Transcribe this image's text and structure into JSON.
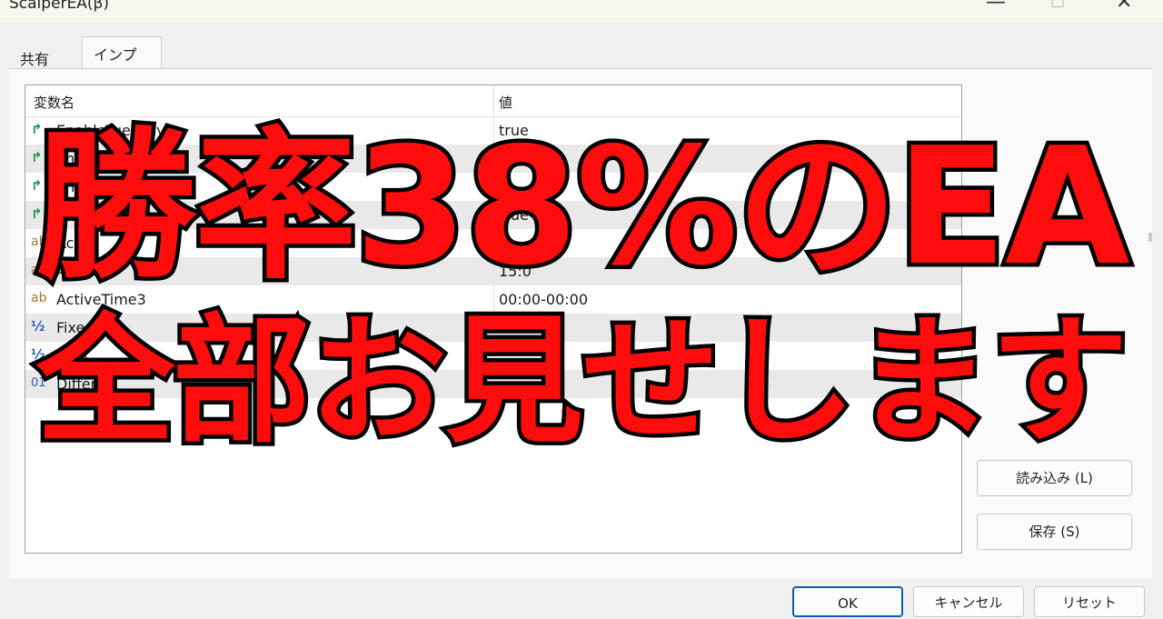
{
  "window": {
    "title": "ScalperEA(β)",
    "minimize_glyph": "—",
    "maximize_glyph": "☐",
    "close_glyph": "✕"
  },
  "tabs": [
    {
      "label": "共有",
      "active": false
    },
    {
      "label": "インプット",
      "active": true
    }
  ],
  "grid": {
    "columns": {
      "name": "変数名",
      "value": "値"
    },
    "rows": [
      {
        "icon": "bool-arrow-icon",
        "glyph": "↱",
        "name": "EnableTuesday",
        "value": "true"
      },
      {
        "icon": "bool-arrow-icon",
        "glyph": "↱",
        "name": "Ena",
        "value": "true"
      },
      {
        "icon": "bool-arrow-icon",
        "glyph": "↱",
        "name": "Ena",
        "value": ""
      },
      {
        "icon": "bool-arrow-icon",
        "glyph": "↱",
        "name": "Ena",
        "value": "true"
      },
      {
        "icon": "string-ab-icon",
        "glyph": "ab",
        "name": "Acti",
        "value": ""
      },
      {
        "icon": "string-ab-icon",
        "glyph": "ab",
        "name": "Ac",
        "value": "15:0"
      },
      {
        "icon": "string-ab-icon",
        "glyph": "ab",
        "name": "ActiveTime3",
        "value": "00:00-00:00"
      },
      {
        "icon": "double-half-icon",
        "glyph": "½",
        "name": "FixedLot",
        "value": ""
      },
      {
        "icon": "double-half-icon",
        "glyph": "½",
        "name": "in pi",
        "value": ""
      },
      {
        "icon": "int-01-icon",
        "glyph": "01",
        "name": "Differ",
        "value": ""
      }
    ]
  },
  "buttons": {
    "load": "読み込み (L)",
    "save": "保存 (S)",
    "ok": "OK",
    "cancel": "キャンセル",
    "reset": "リセット"
  },
  "overlay": {
    "line1": "勝率38%のEA",
    "line2": "全部お見せします",
    "fill_color": "#ff0d0d",
    "stroke_color": "#000000"
  }
}
